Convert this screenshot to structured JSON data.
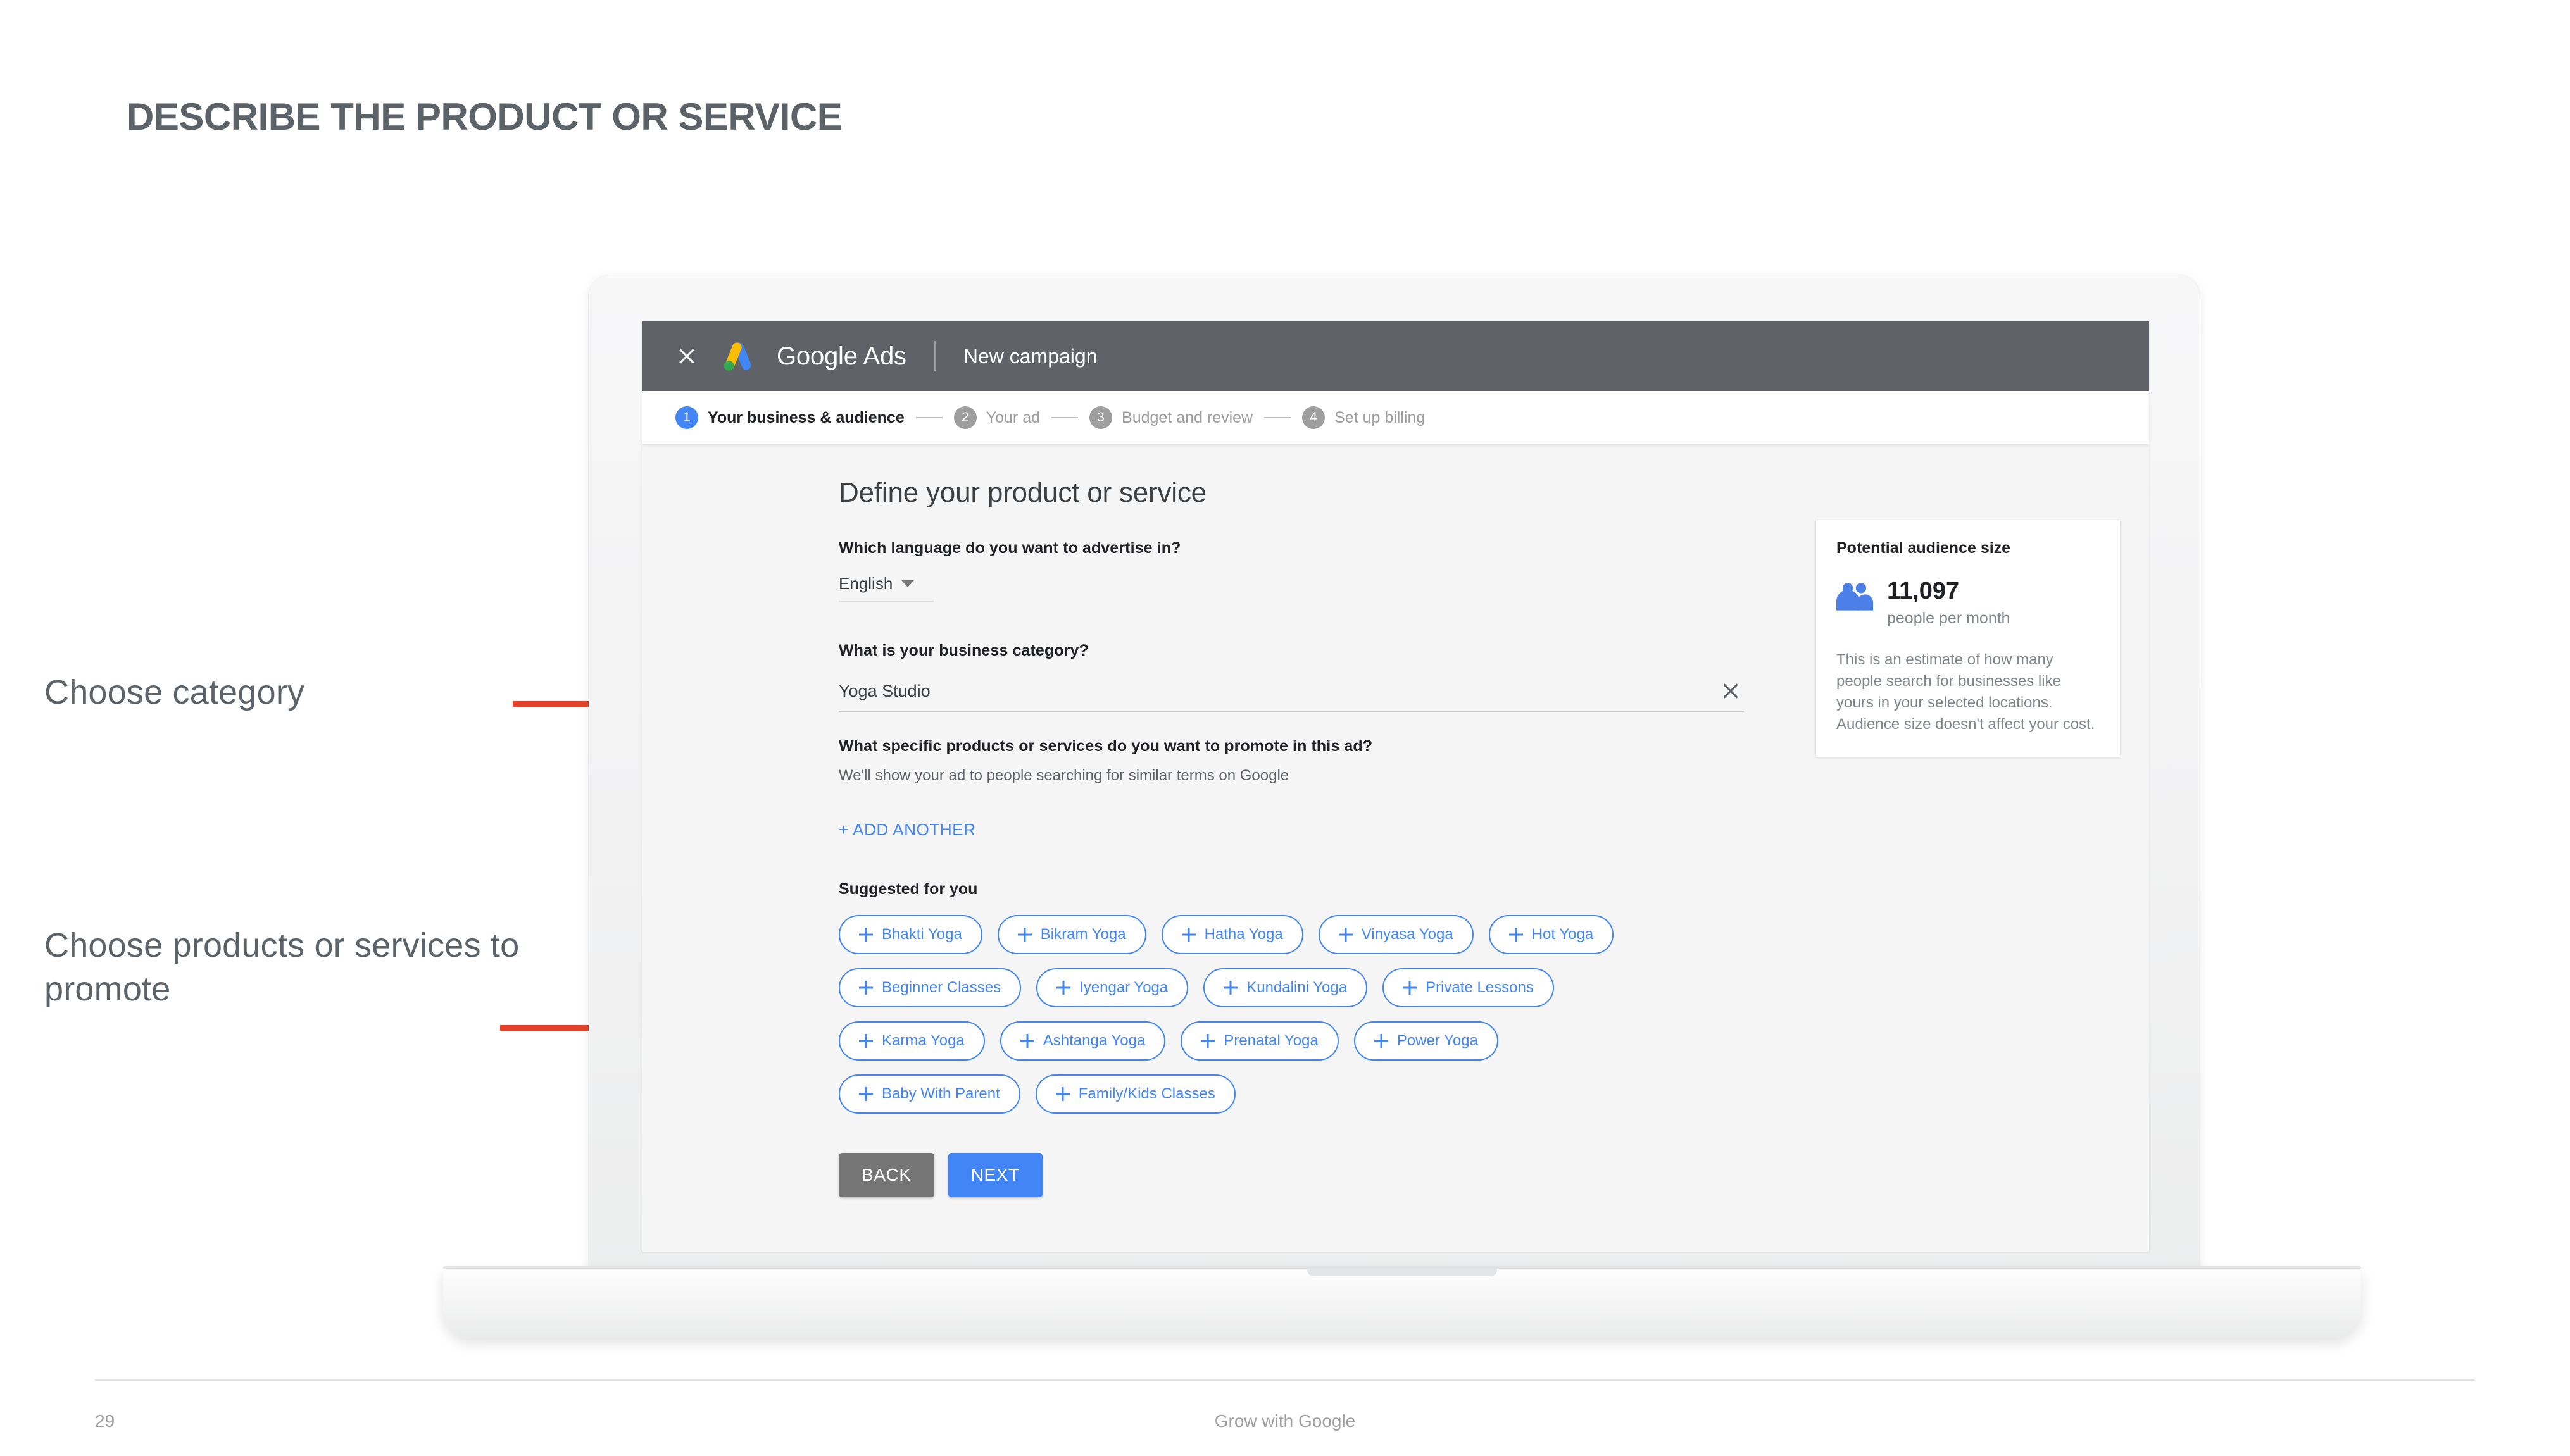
{
  "slide": {
    "title": "DESCRIBE THE PRODUCT OR SERVICE",
    "title_color": "#5b6369"
  },
  "annotations": {
    "line_color": "#e8412b",
    "items": [
      {
        "text": "Choose category"
      },
      {
        "text": "Choose products or services to promote"
      }
    ]
  },
  "app": {
    "topbar": {
      "close_icon": "close-icon",
      "logo_icon": "google-ads-logo-icon",
      "brand": "Google Ads",
      "campaign": "New campaign",
      "bg_color": "#5f6368"
    },
    "stepper": {
      "active_color": "#4285f4",
      "inactive_color": "#9e9e9e",
      "steps": [
        {
          "num": "1",
          "label": "Your business & audience",
          "active": true
        },
        {
          "num": "2",
          "label": "Your ad",
          "active": false
        },
        {
          "num": "3",
          "label": "Budget and review",
          "active": false
        },
        {
          "num": "4",
          "label": "Set up billing",
          "active": false
        }
      ]
    },
    "form": {
      "heading": "Define your product or service",
      "language_question": "Which language do you want to advertise in?",
      "language_value": "English",
      "category_question": "What is your business category?",
      "category_value": "Yoga Studio",
      "category_clear_icon": "clear-icon",
      "products_question": "What specific products or services do you want to promote in this ad?",
      "products_help": "We'll show your ad to people searching for similar terms on Google",
      "add_another_label": "+ ADD ANOTHER",
      "suggested_title": "Suggested for you",
      "suggested_chips": [
        "Bhakti Yoga",
        "Bikram Yoga",
        "Hatha Yoga",
        "Vinyasa Yoga",
        "Hot Yoga",
        "Beginner Classes",
        "Iyengar Yoga",
        "Kundalini Yoga",
        "Private Lessons",
        "Karma Yoga",
        "Ashtanga Yoga",
        "Prenatal Yoga",
        "Power Yoga",
        "Baby With Parent",
        "Family/Kids Classes"
      ],
      "chip_color": "#4285f4",
      "back_label": "BACK",
      "next_label": "NEXT"
    },
    "audience_card": {
      "title": "Potential audience size",
      "icon": "people-icon",
      "count": "11,097",
      "unit": "people per month",
      "description": "This is an estimate of how many people search for businesses like yours in your selected locations. Audience size doesn't affect your cost."
    }
  },
  "footer": {
    "page_number": "29",
    "brand": "Grow with Google"
  }
}
